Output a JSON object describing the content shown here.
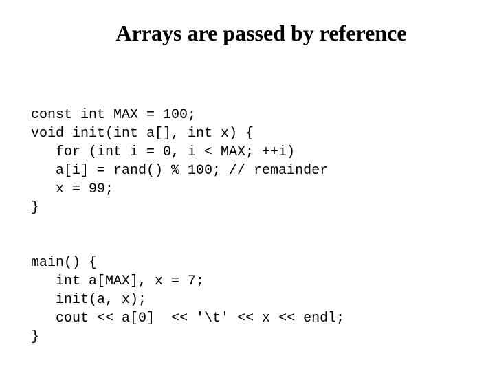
{
  "title": "Arrays are passed by reference",
  "code1": {
    "l1": "const int MAX = 100;",
    "l2": "void init(int a[], int x) {",
    "l3": "   for (int i = 0, i < MAX; ++i)",
    "l4": "   a[i] = rand() % 100; // remainder",
    "l5": "   x = 99;",
    "l6": "}"
  },
  "code2": {
    "l1": "main() {",
    "l2": "   int a[MAX], x = 7;",
    "l3": "   init(a, x);",
    "l4": "   cout << a[0]  << '\\t' << x << endl;",
    "l5": "}"
  }
}
